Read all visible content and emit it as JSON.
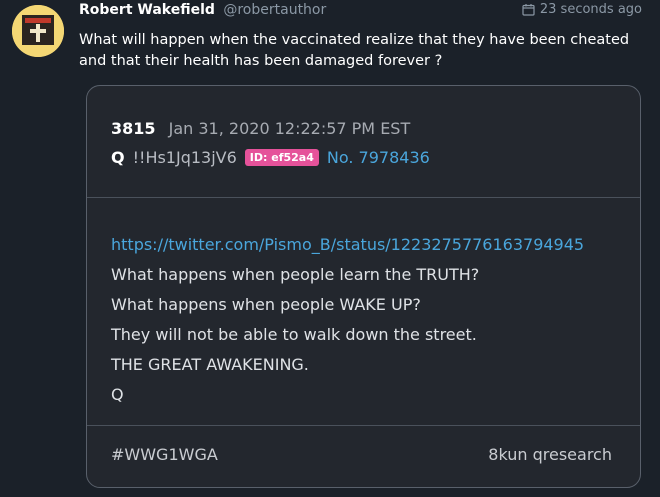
{
  "tweet": {
    "author": "Robert Wakefield",
    "handle": "@robertauthor",
    "time": "23 seconds ago",
    "text_line1": "What will happen when the vaccinated realize that they have been cheated",
    "text_line2": "and that their health has been damaged forever ?"
  },
  "card": {
    "post_number": "3815",
    "date": "Jan 31, 2020 12:22:57 PM EST",
    "name": "Q",
    "tripcode": "!!Hs1Jq13jV6",
    "id_badge": "ID: ef52a4",
    "post_no": "No. 7978436",
    "lines": [
      "https://twitter.com/Pismo_B/status/1223275776163794945",
      "What happens when people learn the TRUTH?",
      "What happens when people WAKE UP?",
      "They will not be able to walk down the street.",
      "THE GREAT AWAKENING.",
      "Q"
    ],
    "hashtag": "#WWG1WGA",
    "source": "8kun qresearch"
  },
  "colors": {
    "background": "#1b2129",
    "card": "#23272e",
    "link": "#4aa6dc",
    "badge": "#e5529a"
  },
  "icons": [
    "avatar",
    "calendar-icon"
  ]
}
